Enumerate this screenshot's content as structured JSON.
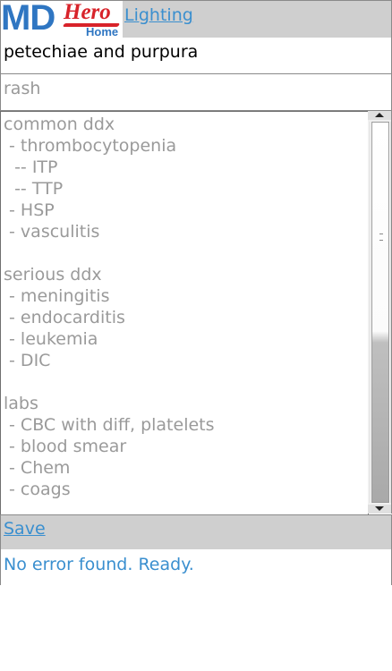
{
  "header": {
    "logo": {
      "md": "MD",
      "hero": "Hero",
      "home": "Home"
    },
    "nav_link": "Lighting"
  },
  "entry": {
    "title": "petechiae and purpura",
    "category": "rash",
    "lines": [
      "common ddx",
      " - thrombocytopenia",
      "  -- ITP",
      "  -- TTP",
      " - HSP",
      " - vasculitis",
      "",
      "serious ddx",
      " - meningitis",
      " - endocarditis",
      " - leukemia",
      " - DIC",
      "",
      "labs",
      " - CBC with diff, platelets",
      " - blood smear",
      " - Chem",
      " - coags"
    ]
  },
  "actions": {
    "save_label": "Save"
  },
  "status": {
    "message": "No error found. Ready."
  },
  "colors": {
    "brand_blue": "#2f76c2",
    "brand_red": "#d8232a",
    "link_blue": "#3a8fcf",
    "bar_gray": "#cfcfcf",
    "muted_text": "#9a9a9a"
  },
  "scrollbar": {
    "position": 0.0,
    "visible_fraction": 1.0
  }
}
